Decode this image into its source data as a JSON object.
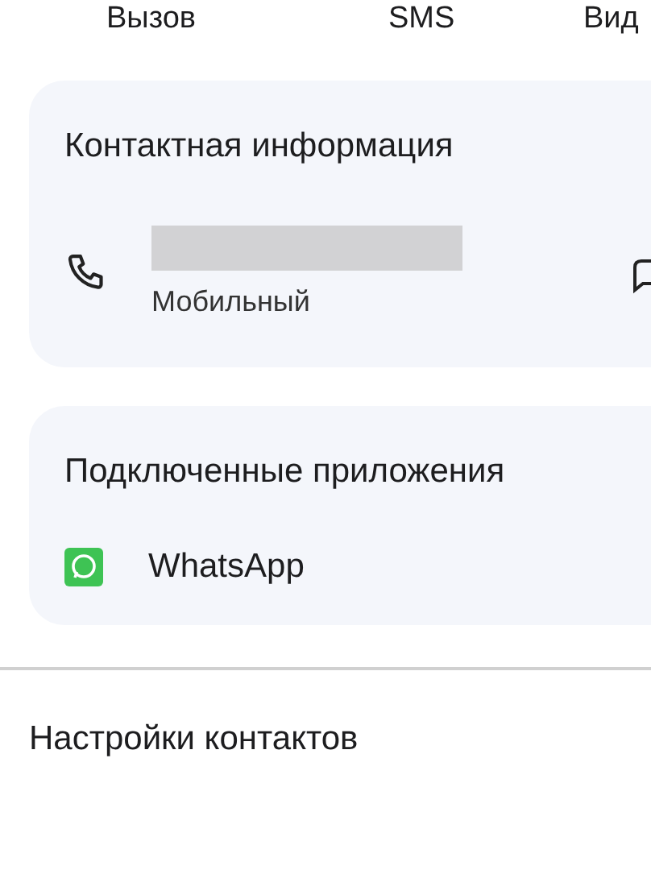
{
  "actions": [
    {
      "label": "Вызов"
    },
    {
      "label": "SMS"
    },
    {
      "label": "Вид"
    }
  ],
  "contact_info": {
    "title": "Контактная информация",
    "phones": [
      {
        "number_hidden": true,
        "type": "Мобильный"
      }
    ]
  },
  "connected_apps": {
    "title": "Подключенные приложения",
    "apps": [
      {
        "name": "WhatsApp"
      }
    ]
  },
  "settings": {
    "title": "Настройки контактов"
  }
}
